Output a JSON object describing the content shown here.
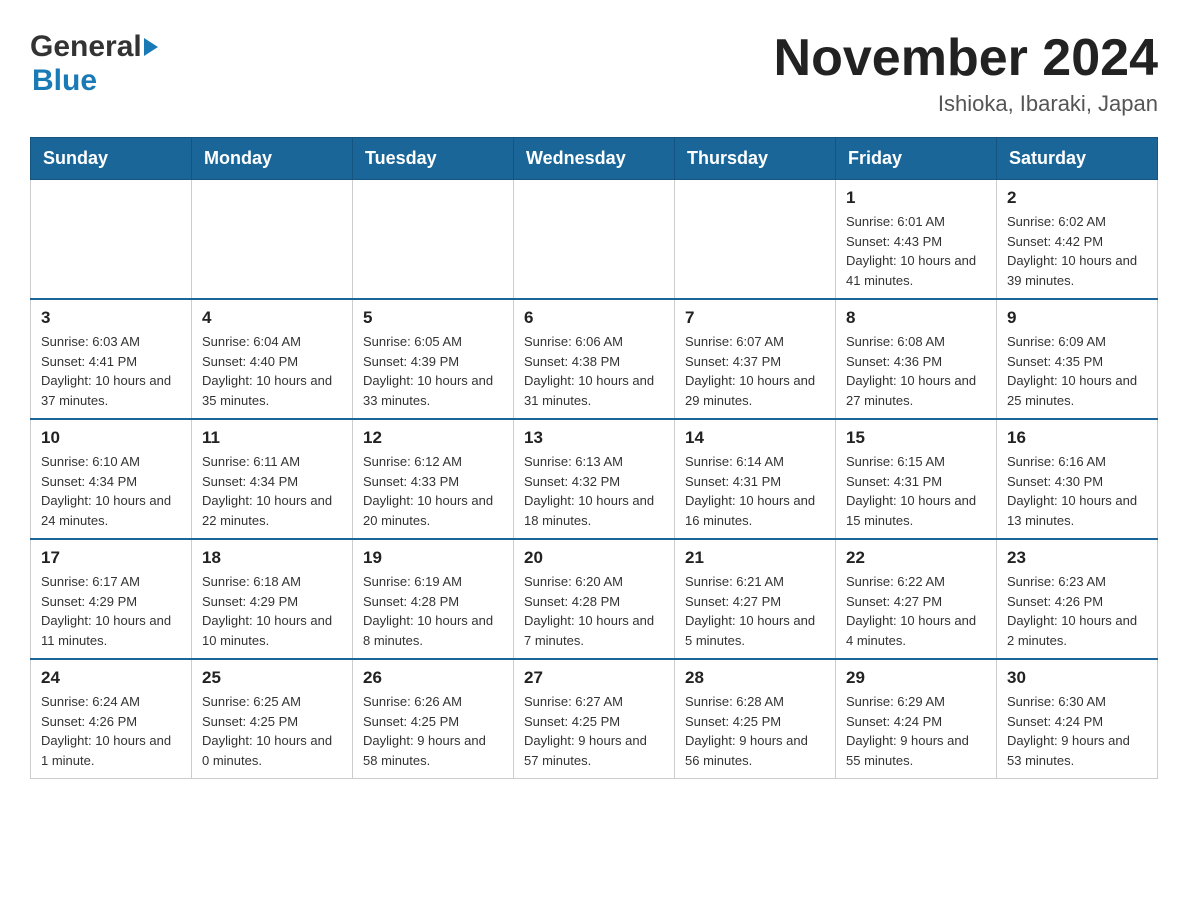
{
  "header": {
    "logo_general": "General",
    "logo_blue": "Blue",
    "title": "November 2024",
    "location": "Ishioka, Ibaraki, Japan"
  },
  "weekdays": [
    "Sunday",
    "Monday",
    "Tuesday",
    "Wednesday",
    "Thursday",
    "Friday",
    "Saturday"
  ],
  "weeks": [
    [
      {
        "day": "",
        "info": ""
      },
      {
        "day": "",
        "info": ""
      },
      {
        "day": "",
        "info": ""
      },
      {
        "day": "",
        "info": ""
      },
      {
        "day": "",
        "info": ""
      },
      {
        "day": "1",
        "info": "Sunrise: 6:01 AM\nSunset: 4:43 PM\nDaylight: 10 hours and 41 minutes."
      },
      {
        "day": "2",
        "info": "Sunrise: 6:02 AM\nSunset: 4:42 PM\nDaylight: 10 hours and 39 minutes."
      }
    ],
    [
      {
        "day": "3",
        "info": "Sunrise: 6:03 AM\nSunset: 4:41 PM\nDaylight: 10 hours and 37 minutes."
      },
      {
        "day": "4",
        "info": "Sunrise: 6:04 AM\nSunset: 4:40 PM\nDaylight: 10 hours and 35 minutes."
      },
      {
        "day": "5",
        "info": "Sunrise: 6:05 AM\nSunset: 4:39 PM\nDaylight: 10 hours and 33 minutes."
      },
      {
        "day": "6",
        "info": "Sunrise: 6:06 AM\nSunset: 4:38 PM\nDaylight: 10 hours and 31 minutes."
      },
      {
        "day": "7",
        "info": "Sunrise: 6:07 AM\nSunset: 4:37 PM\nDaylight: 10 hours and 29 minutes."
      },
      {
        "day": "8",
        "info": "Sunrise: 6:08 AM\nSunset: 4:36 PM\nDaylight: 10 hours and 27 minutes."
      },
      {
        "day": "9",
        "info": "Sunrise: 6:09 AM\nSunset: 4:35 PM\nDaylight: 10 hours and 25 minutes."
      }
    ],
    [
      {
        "day": "10",
        "info": "Sunrise: 6:10 AM\nSunset: 4:34 PM\nDaylight: 10 hours and 24 minutes."
      },
      {
        "day": "11",
        "info": "Sunrise: 6:11 AM\nSunset: 4:34 PM\nDaylight: 10 hours and 22 minutes."
      },
      {
        "day": "12",
        "info": "Sunrise: 6:12 AM\nSunset: 4:33 PM\nDaylight: 10 hours and 20 minutes."
      },
      {
        "day": "13",
        "info": "Sunrise: 6:13 AM\nSunset: 4:32 PM\nDaylight: 10 hours and 18 minutes."
      },
      {
        "day": "14",
        "info": "Sunrise: 6:14 AM\nSunset: 4:31 PM\nDaylight: 10 hours and 16 minutes."
      },
      {
        "day": "15",
        "info": "Sunrise: 6:15 AM\nSunset: 4:31 PM\nDaylight: 10 hours and 15 minutes."
      },
      {
        "day": "16",
        "info": "Sunrise: 6:16 AM\nSunset: 4:30 PM\nDaylight: 10 hours and 13 minutes."
      }
    ],
    [
      {
        "day": "17",
        "info": "Sunrise: 6:17 AM\nSunset: 4:29 PM\nDaylight: 10 hours and 11 minutes."
      },
      {
        "day": "18",
        "info": "Sunrise: 6:18 AM\nSunset: 4:29 PM\nDaylight: 10 hours and 10 minutes."
      },
      {
        "day": "19",
        "info": "Sunrise: 6:19 AM\nSunset: 4:28 PM\nDaylight: 10 hours and 8 minutes."
      },
      {
        "day": "20",
        "info": "Sunrise: 6:20 AM\nSunset: 4:28 PM\nDaylight: 10 hours and 7 minutes."
      },
      {
        "day": "21",
        "info": "Sunrise: 6:21 AM\nSunset: 4:27 PM\nDaylight: 10 hours and 5 minutes."
      },
      {
        "day": "22",
        "info": "Sunrise: 6:22 AM\nSunset: 4:27 PM\nDaylight: 10 hours and 4 minutes."
      },
      {
        "day": "23",
        "info": "Sunrise: 6:23 AM\nSunset: 4:26 PM\nDaylight: 10 hours and 2 minutes."
      }
    ],
    [
      {
        "day": "24",
        "info": "Sunrise: 6:24 AM\nSunset: 4:26 PM\nDaylight: 10 hours and 1 minute."
      },
      {
        "day": "25",
        "info": "Sunrise: 6:25 AM\nSunset: 4:25 PM\nDaylight: 10 hours and 0 minutes."
      },
      {
        "day": "26",
        "info": "Sunrise: 6:26 AM\nSunset: 4:25 PM\nDaylight: 9 hours and 58 minutes."
      },
      {
        "day": "27",
        "info": "Sunrise: 6:27 AM\nSunset: 4:25 PM\nDaylight: 9 hours and 57 minutes."
      },
      {
        "day": "28",
        "info": "Sunrise: 6:28 AM\nSunset: 4:25 PM\nDaylight: 9 hours and 56 minutes."
      },
      {
        "day": "29",
        "info": "Sunrise: 6:29 AM\nSunset: 4:24 PM\nDaylight: 9 hours and 55 minutes."
      },
      {
        "day": "30",
        "info": "Sunrise: 6:30 AM\nSunset: 4:24 PM\nDaylight: 9 hours and 53 minutes."
      }
    ]
  ]
}
